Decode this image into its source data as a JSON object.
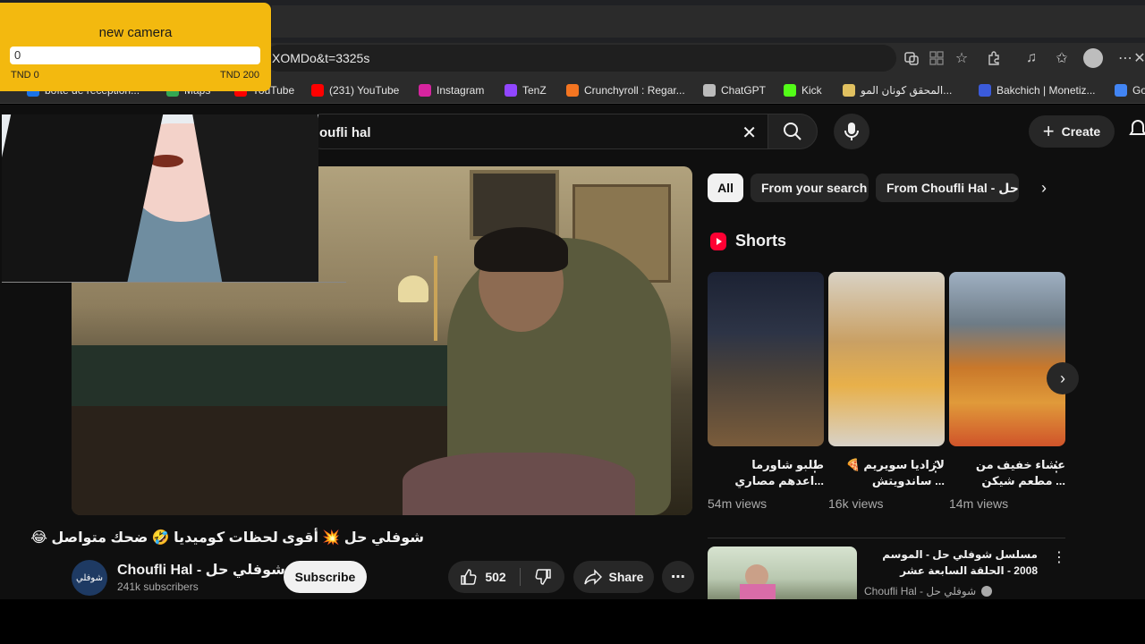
{
  "browser": {
    "url": "XOMDo&t=3325s",
    "bookmarks": [
      {
        "label": "boîte de réception...",
        "color": "#1a73e8"
      },
      {
        "label": "Maps",
        "color": "#34a853"
      },
      {
        "label": "YouTube",
        "color": "#ff0000"
      },
      {
        "label": "(231) YouTube",
        "color": "#ff0000"
      },
      {
        "label": "Instagram",
        "color": "#d6249f"
      },
      {
        "label": "TenZ",
        "color": "#9146ff"
      },
      {
        "label": "Crunchyroll : Regar...",
        "color": "#f47521"
      },
      {
        "label": "ChatGPT",
        "color": "#bbbbbb"
      },
      {
        "label": "Kick",
        "color": "#53fc18"
      },
      {
        "label": "المحقق كونان المو...",
        "color": "#e0c060"
      },
      {
        "label": "Bakchich | Monetiz...",
        "color": "#3b5bdb"
      },
      {
        "label": "Go",
        "color": "#4285f4"
      }
    ]
  },
  "youtube": {
    "search_query": "oufli hal",
    "create_label": "Create",
    "video": {
      "title": "شوفلي حل 💥 أقوى لحظات كوميديا 🤣 ضحك متواصل 😂",
      "channel_name": "Choufli Hal - شوفلي حل",
      "channel_avatar_text": "شوفلي",
      "subscribers": "241k subscribers",
      "subscribe_label": "Subscribe",
      "likes": "502",
      "share_label": "Share"
    },
    "chips": [
      {
        "label": "All",
        "active": true
      },
      {
        "label": "From your search",
        "active": false
      },
      {
        "label": "From Choufli Hal - شوفلي حل",
        "active": false
      }
    ],
    "shorts_heading": "Shorts",
    "shorts": [
      {
        "title": "طلبو شاورما ...اعدهم مصاري",
        "views": "54m views"
      },
      {
        "title": "لازاديا سويريم 🍕 ... ساندويتش",
        "views": "16k views"
      },
      {
        "title": "عشاء خفيف من ... مطعم شيكن",
        "views": "14m views"
      }
    ],
    "recommended": {
      "title": "مسلسل شوفلي حل - الموسم 2008 - الحلقة السابعة عشر",
      "channel": "Choufli Hal - شوفلي حل"
    }
  },
  "goal_widget": {
    "title": "new camera",
    "current": "0",
    "min_label": "TND 0",
    "max_label": "TND 200",
    "progress": 0
  }
}
